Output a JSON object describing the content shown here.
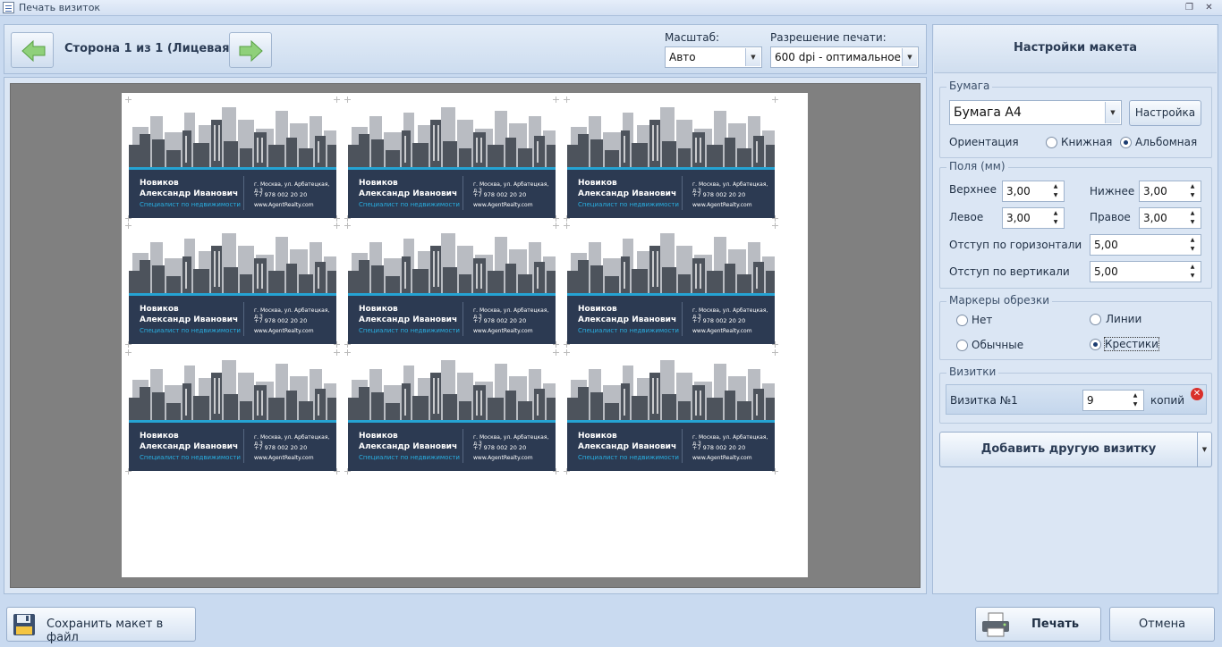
{
  "window": {
    "title": "Печать визиток"
  },
  "toolbar": {
    "side_label": "Сторона 1 из 1 (Лицевая)",
    "scale_label": "Масштаб:",
    "scale_value": "Авто",
    "resolution_label": "Разрешение печати:",
    "resolution_value": "600 dpi - оптимальное"
  },
  "card": {
    "surname": "Новиков",
    "name": "Александр Иванович",
    "job": "Специалист по недвижимости",
    "address": "г. Москва, ул. Арбатецкая, д.3",
    "phone": "+7 978 002 20 20",
    "website": "www.AgentRealty.com"
  },
  "settings": {
    "title": "Настройки макета",
    "paper": {
      "group": "Бумага",
      "value": "Бумага А4",
      "setup_button": "Настройка",
      "orientation_label": "Ориентация",
      "portrait": "Книжная",
      "landscape": "Альбомная",
      "selected": "landscape"
    },
    "margins": {
      "group": "Поля (мм)",
      "top_label": "Верхнее",
      "top": "3,00",
      "bottom_label": "Нижнее",
      "bottom": "3,00",
      "left_label": "Левое",
      "left": "3,00",
      "right_label": "Правое",
      "right": "3,00",
      "hgap_label": "Отступ по горизонтали",
      "hgap": "5,00",
      "vgap_label": "Отступ по вертикали",
      "vgap": "5,00"
    },
    "markers": {
      "group": "Маркеры обрезки",
      "none": "Нет",
      "lines": "Линии",
      "normal": "Обычные",
      "crosses": "Крестики",
      "selected": "crosses"
    },
    "cards": {
      "group": "Визитки",
      "item_label": "Визитка №1",
      "copies": "9",
      "copies_unit": "копий"
    },
    "add_button": "Добавить другую визитку"
  },
  "footer": {
    "save_button": "Сохранить макет в файл",
    "print_button": "Печать",
    "cancel_button": "Отмена"
  },
  "colors": {
    "band": "#2c3a52",
    "accent": "#25a3d3",
    "skyline": "#4d535c",
    "skyline_back": "#b9bcc2"
  }
}
